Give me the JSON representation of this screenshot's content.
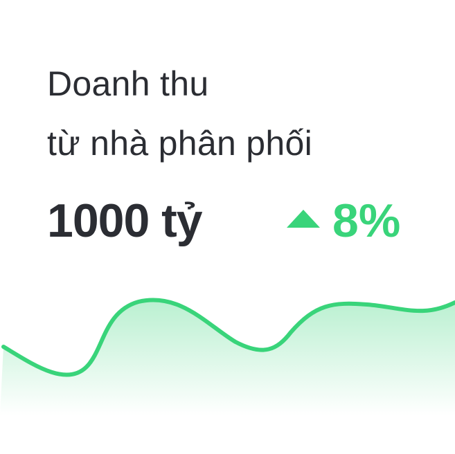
{
  "card": {
    "title_line1": "Doanh thu",
    "title_line2": "từ nhà phân phối",
    "value": "1000 tỷ",
    "change": "8%",
    "trend_direction": "up",
    "trend_icon": "triangle-up-icon",
    "accent_color": "#39d47a",
    "text_color": "#2b2d33"
  }
}
